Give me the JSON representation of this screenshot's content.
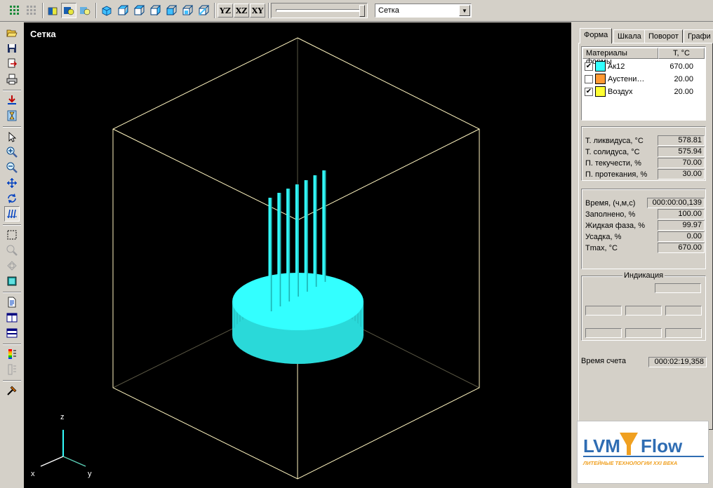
{
  "toolbar": {
    "view_buttons": [
      "YZ",
      "XZ",
      "XY"
    ],
    "combo_value": "Сетка",
    "slider_position": 1.0
  },
  "viewport": {
    "title": "Сетка",
    "axis_labels": {
      "z": "z",
      "x": "x",
      "y": "y"
    }
  },
  "panel": {
    "tabs": [
      "Форма",
      "Шкала",
      "Поворот",
      "Графи"
    ],
    "materials": {
      "col_name": "Материалы формы",
      "col_temp": "T, °C",
      "rows": [
        {
          "checked": true,
          "color": "#33ffff",
          "name": "Ак12",
          "temp": "670.00"
        },
        {
          "checked": false,
          "color": "#ff9933",
          "name": "Аустени…",
          "temp": "20.00"
        },
        {
          "checked": true,
          "color": "#ffff33",
          "name": "Воздух",
          "temp": "20.00"
        }
      ]
    },
    "props": [
      {
        "label": "Т. ликвидуса, °С",
        "value": "578.81"
      },
      {
        "label": "Т. солидуса, °С",
        "value": "575.94"
      },
      {
        "label": "П. текучести, %",
        "value": "70.00"
      },
      {
        "label": "П. протекания, %",
        "value": "30.00"
      }
    ],
    "state": [
      {
        "label": "Время, (ч,м,с)",
        "value": "000:00:00,139"
      },
      {
        "label": "Заполнено, %",
        "value": "100.00"
      },
      {
        "label": "Жидкая фаза, %",
        "value": "99.97"
      },
      {
        "label": "Усадка, %",
        "value": "0.00"
      },
      {
        "label": "Tmax, °C",
        "value": "670.00"
      }
    ],
    "indication_title": "Индикация",
    "calc_time_label": "Время счета",
    "calc_time_value": "000:02:19,358"
  },
  "logo": {
    "text_left": "LVM",
    "text_right": "Flow",
    "tagline": "ЛИТЕЙНЫЕ ТЕХНОЛОГИИ XXI ВЕКА"
  },
  "colors": {
    "cast": "#33ffff",
    "cast_side": "#2ad9d9",
    "frame": "#fff5c0",
    "logo_blue": "#2f6db3",
    "logo_orange": "#f0a020"
  }
}
